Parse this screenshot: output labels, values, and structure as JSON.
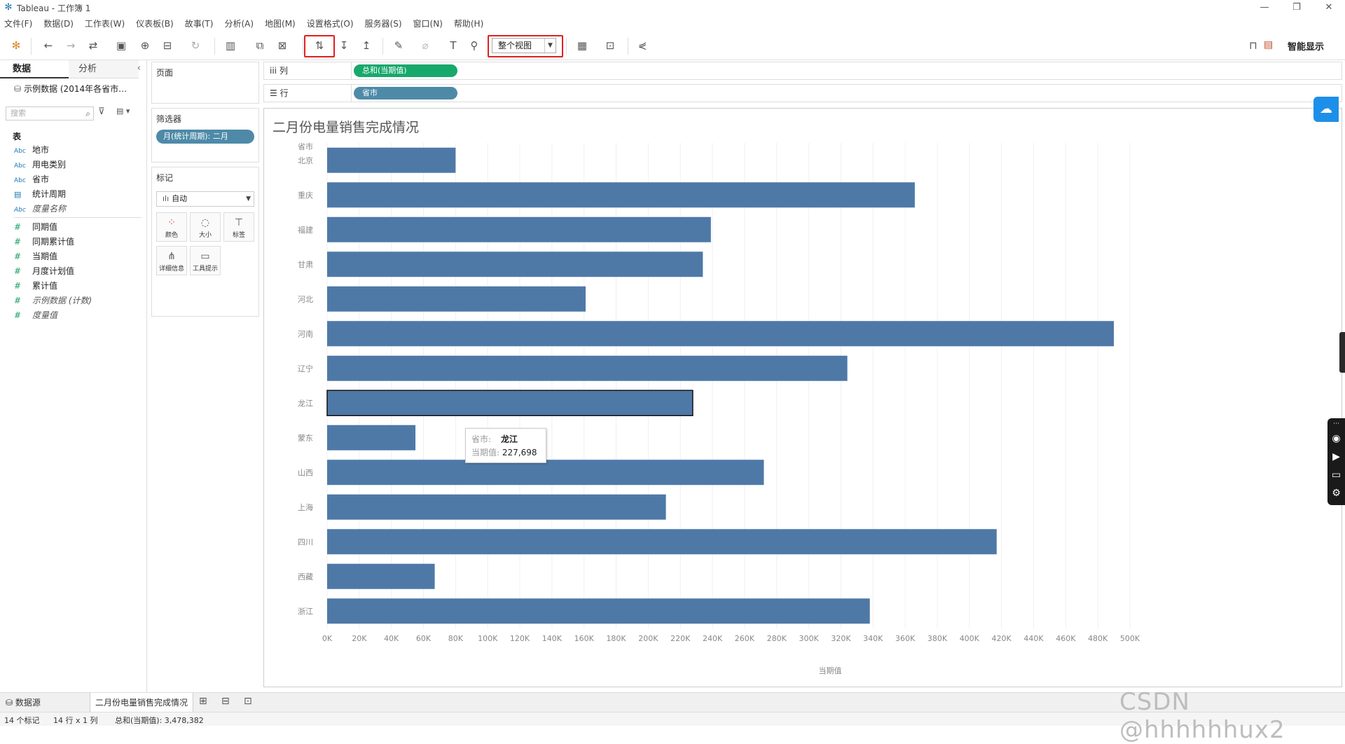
{
  "window": {
    "title": "Tableau - 工作簿 1",
    "minimize": "—",
    "restore": "❐",
    "close": "✕"
  },
  "menu": [
    "文件(F)",
    "数据(D)",
    "工作表(W)",
    "仪表板(B)",
    "故事(T)",
    "分析(A)",
    "地图(M)",
    "设置格式(O)",
    "服务器(S)",
    "窗口(N)",
    "帮助(H)"
  ],
  "toolbar": {
    "fit_selector": "整个视图",
    "smart_show": "智能显示",
    "highlight_color": "#e02020"
  },
  "left_pane": {
    "tab_data": "数据",
    "tab_analysis": "分析",
    "datasource": "示例数据 (2014年各省市…",
    "search_placeholder": "搜索",
    "tables_header": "表",
    "dimensions": [
      {
        "type": "Abc",
        "name": "地市",
        "italic": false
      },
      {
        "type": "Abc",
        "name": "用电类别",
        "italic": false
      },
      {
        "type": "Abc",
        "name": "省市",
        "italic": false
      },
      {
        "type": "cal",
        "name": "统计周期",
        "italic": false
      },
      {
        "type": "Abc",
        "name": "度量名称",
        "italic": true
      }
    ],
    "measures": [
      {
        "name": "同期值",
        "italic": false
      },
      {
        "name": "同期累计值",
        "italic": false
      },
      {
        "name": "当期值",
        "italic": false
      },
      {
        "name": "月度计划值",
        "italic": false
      },
      {
        "name": "累计值",
        "italic": false
      },
      {
        "name": "示例数据 (计数)",
        "italic": true
      },
      {
        "name": "度量值",
        "italic": true
      }
    ]
  },
  "cards": {
    "pages": "页面",
    "filters": "筛选器",
    "filter_pill": "月(统计周期): 二月",
    "marks": "标记",
    "marks_type": "自动",
    "mark_buttons": [
      {
        "label": "颜色",
        "icon": "color-icon"
      },
      {
        "label": "大小",
        "icon": "size-icon"
      },
      {
        "label": "标签",
        "icon": "label-icon"
      },
      {
        "label": "详细信息",
        "icon": "detail-icon"
      },
      {
        "label": "工具提示",
        "icon": "tooltip-icon"
      }
    ]
  },
  "shelves": {
    "columns_label": "列",
    "columns_pill": "总和(当期值)",
    "columns_color": "#17a86c",
    "rows_label": "行",
    "rows_pill": "省市",
    "rows_color": "#4e8aa8"
  },
  "chart_data": {
    "type": "bar",
    "orientation": "horizontal",
    "title": "二月份电量销售完成情况",
    "row_header": "省市",
    "categories": [
      "北京",
      "重庆",
      "福建",
      "甘肃",
      "河北",
      "河南",
      "辽宁",
      "龙江",
      "蒙东",
      "山西",
      "上海",
      "四川",
      "西藏",
      "浙江"
    ],
    "values": [
      80000,
      366000,
      239000,
      234000,
      161000,
      490000,
      324000,
      227698,
      55000,
      272000,
      211000,
      417000,
      67000,
      338000
    ],
    "xlabel": "当期值",
    "xlim": [
      0,
      500000
    ],
    "x_ticks": [
      "0K",
      "20K",
      "40K",
      "60K",
      "80K",
      "100K",
      "120K",
      "140K",
      "160K",
      "180K",
      "200K",
      "220K",
      "240K",
      "260K",
      "280K",
      "300K",
      "320K",
      "340K",
      "360K",
      "380K",
      "400K",
      "420K",
      "440K",
      "460K",
      "480K",
      "500K"
    ],
    "bar_color": "#4e79a7",
    "selected": "龙江",
    "grid": true
  },
  "tooltip": {
    "k1": "省市:",
    "v1": "龙江",
    "k2": "当期值:",
    "v2": "227,698"
  },
  "bottom": {
    "datasource_tab": "数据源",
    "sheet_tab": "二月份电量销售完成情况",
    "status_marks": "14 个标记",
    "status_rows": "14 行 x 1 列",
    "status_sum": "总和(当期值): 3,478,382",
    "watermark": "CSDN @hhhhhhux2"
  }
}
